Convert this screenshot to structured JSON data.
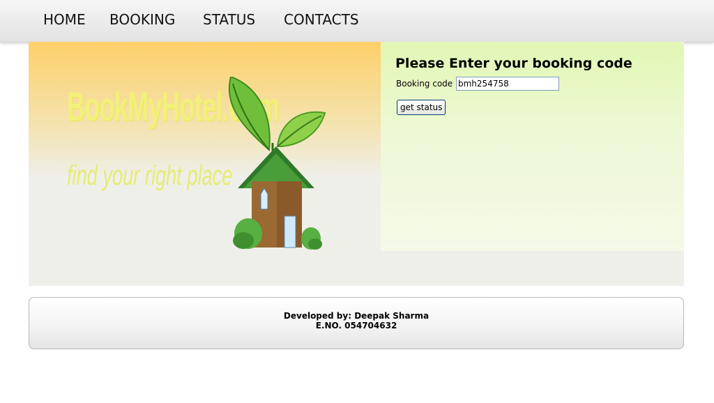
{
  "nav": {
    "items": [
      {
        "label": "HOME"
      },
      {
        "label": "BOOKING"
      },
      {
        "label": "STATUS"
      },
      {
        "label": "CONTACTS"
      }
    ]
  },
  "banner": {
    "logo_text": "BookMyHotel.com",
    "tagline": "find your right place",
    "icon": "house-with-leaves"
  },
  "form": {
    "title": "Please Enter your booking code",
    "code_label": "Booking code",
    "code_value": "bmh254758",
    "button_label": "get status"
  },
  "footer": {
    "developer": "Developed by: Deepak Sharma",
    "enrollment": "E.NO. 054704632"
  },
  "colors": {
    "banner_top": "#fdd06a",
    "panel_top": "#e2f7b4",
    "page_bg": "#efefea"
  }
}
